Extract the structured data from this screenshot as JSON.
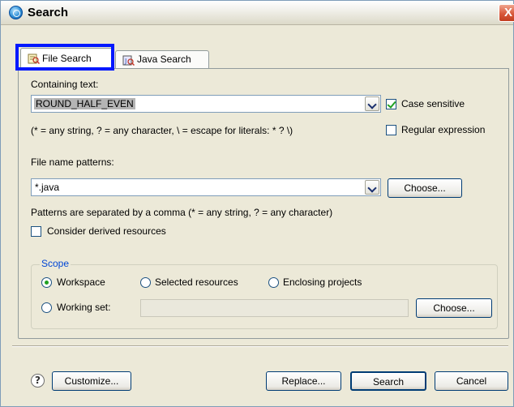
{
  "window": {
    "title": "Search",
    "close_glyph": "X"
  },
  "tabs": [
    {
      "label": "File Search",
      "icon": "file-search-icon",
      "active": true
    },
    {
      "label": "Java Search",
      "icon": "java-search-icon",
      "active": false
    }
  ],
  "containing_text": {
    "label": "Containing text:",
    "value": "ROUND_HALF_EVEN",
    "hint": "(* = any string, ? = any character, \\ = escape for literals: * ? \\)",
    "case_sensitive": {
      "label": "Case sensitive",
      "checked": true
    },
    "regular_expression": {
      "label": "Regular expression",
      "checked": false
    }
  },
  "file_name_patterns": {
    "label": "File name patterns:",
    "value": "*.java",
    "choose_label": "Choose...",
    "hint": "Patterns are separated by a comma (* = any string, ? = any character)",
    "consider_derived": {
      "label": "Consider derived resources",
      "checked": false
    }
  },
  "scope": {
    "title": "Scope",
    "options": {
      "workspace": {
        "label": "Workspace",
        "selected": true
      },
      "selected_resources": {
        "label": "Selected resources",
        "selected": false
      },
      "enclosing_projects": {
        "label": "Enclosing projects",
        "selected": false
      },
      "working_set": {
        "label": "Working set:",
        "selected": false
      }
    },
    "working_set_value": "",
    "choose_label": "Choose..."
  },
  "footer": {
    "help_glyph": "?",
    "customize_label": "Customize...",
    "replace_label": "Replace...",
    "search_label": "Search",
    "cancel_label": "Cancel"
  },
  "colors": {
    "highlight_box": "#0018ff",
    "scope_title": "#0046d5",
    "check_mark": "#21a121"
  }
}
